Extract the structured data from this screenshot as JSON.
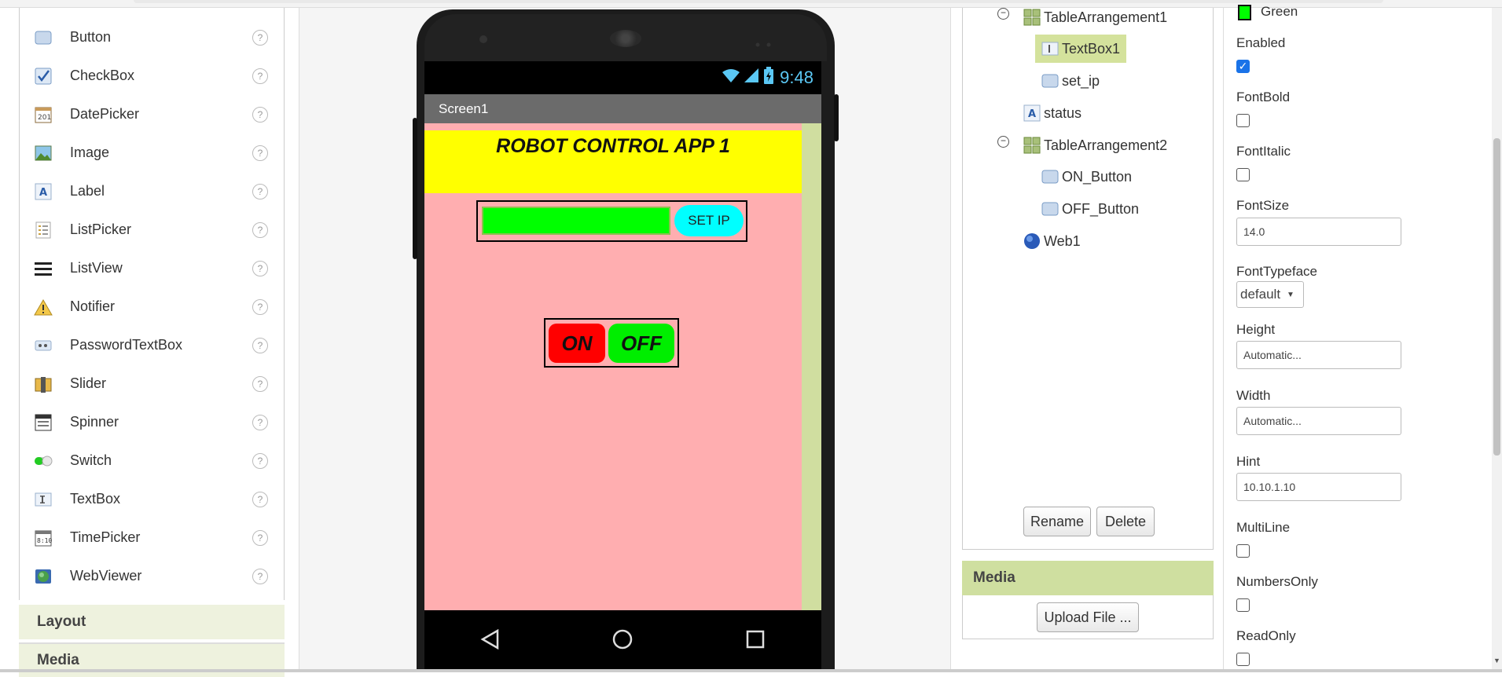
{
  "palette": {
    "items": [
      {
        "label": "Button"
      },
      {
        "label": "CheckBox"
      },
      {
        "label": "DatePicker"
      },
      {
        "label": "Image"
      },
      {
        "label": "Label"
      },
      {
        "label": "ListPicker"
      },
      {
        "label": "ListView"
      },
      {
        "label": "Notifier"
      },
      {
        "label": "PasswordTextBox"
      },
      {
        "label": "Slider"
      },
      {
        "label": "Spinner"
      },
      {
        "label": "Switch"
      },
      {
        "label": "TextBox"
      },
      {
        "label": "TimePicker"
      },
      {
        "label": "WebViewer"
      }
    ],
    "help_glyph": "?",
    "sections": {
      "layout": "Layout",
      "media": "Media"
    }
  },
  "phone": {
    "time": "9:48",
    "screen_title": "Screen1",
    "banner_text": "ROBOT CONTROL APP 1",
    "set_ip_label": "SET IP",
    "on_label": "ON",
    "off_label": "OFF"
  },
  "tree": {
    "nodes": {
      "ta1": "TableArrangement1",
      "textbox1": "TextBox1",
      "set_ip": "set_ip",
      "status": "status",
      "ta2": "TableArrangement2",
      "on_button": "ON_Button",
      "off_button": "OFF_Button",
      "web1": "Web1"
    },
    "collapse_glyph": "−",
    "rename_label": "Rename",
    "delete_label": "Delete"
  },
  "media": {
    "title": "Media",
    "upload_label": "Upload File ..."
  },
  "properties": {
    "bg_color_value": "Green",
    "enabled_label": "Enabled",
    "enabled_checked": true,
    "fontbold_label": "FontBold",
    "fontitalic_label": "FontItalic",
    "fontsize_label": "FontSize",
    "fontsize_value": "14.0",
    "fonttypeface_label": "FontTypeface",
    "fonttypeface_value": "default",
    "height_label": "Height",
    "height_value": "Automatic...",
    "width_label": "Width",
    "width_value": "Automatic...",
    "hint_label": "Hint",
    "hint_value": "10.10.1.10",
    "multiline_label": "MultiLine",
    "numbersonly_label": "NumbersOnly",
    "readonly_label": "ReadOnly"
  },
  "colors": {
    "screen_bg": "#ffaeb0",
    "banner": "#ffff00",
    "textbox_green": "#00ff00",
    "setip_cyan": "#00ffff",
    "on_red": "#ff0000",
    "off_green": "#00ee00",
    "accent_panel": "#cfdfa0"
  }
}
